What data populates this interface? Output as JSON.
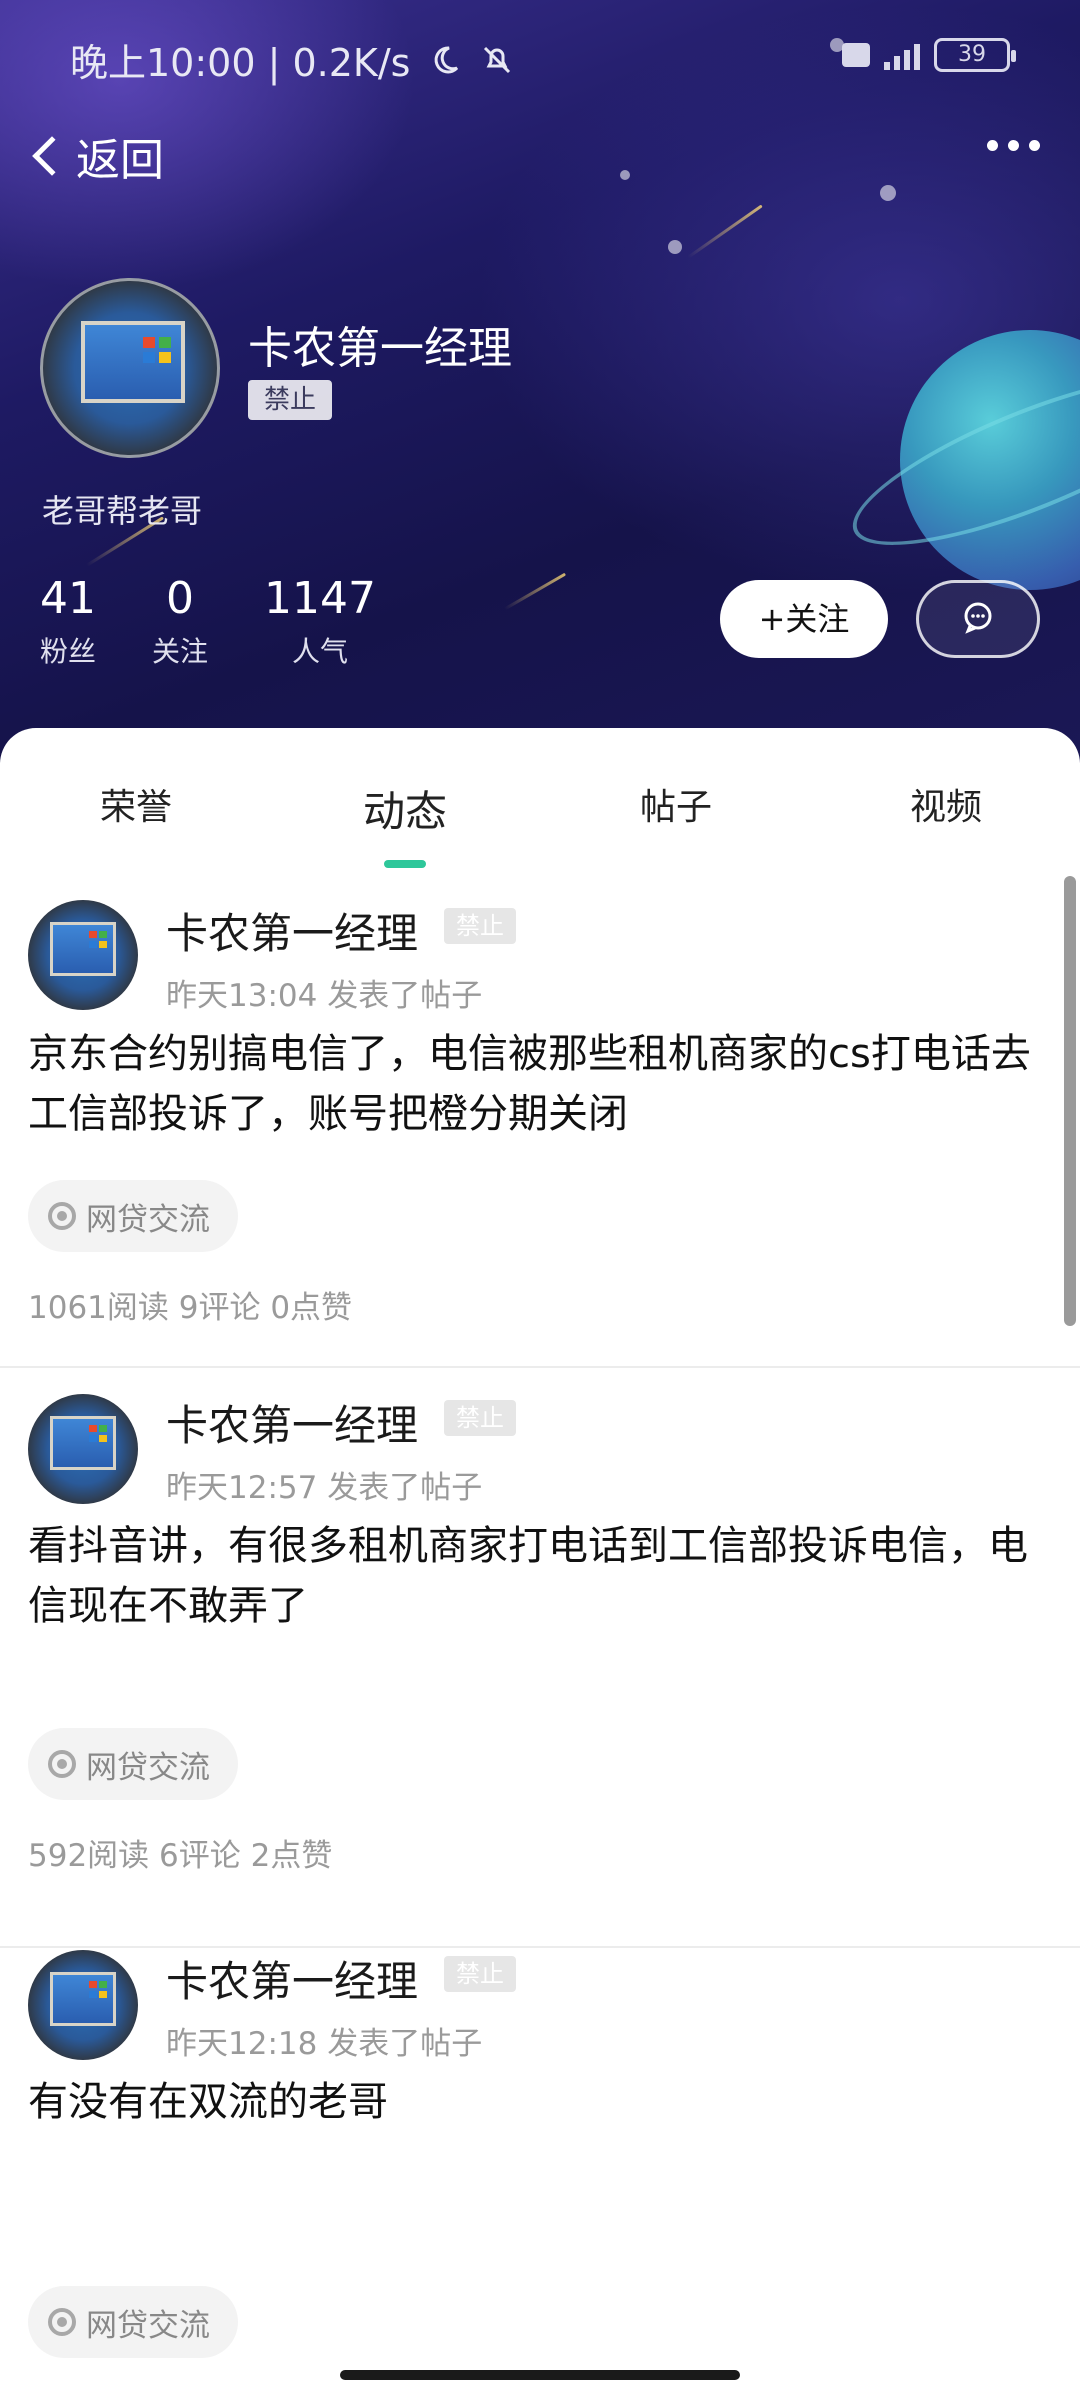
{
  "status_bar": {
    "left_text": "晚上10:00 | 0.2K/s",
    "battery": "39"
  },
  "nav": {
    "back_label": "返回"
  },
  "profile": {
    "name": "卡农第一经理",
    "badge": "禁止",
    "bio": "老哥帮老哥",
    "stats": [
      {
        "value": "41",
        "label": "粉丝"
      },
      {
        "value": "0",
        "label": "关注"
      },
      {
        "value": "1147",
        "label": "人气"
      }
    ],
    "follow_label": "+关注"
  },
  "tabs": [
    {
      "label": "荣誉"
    },
    {
      "label": "动态"
    },
    {
      "label": "帖子"
    },
    {
      "label": "视频"
    }
  ],
  "active_tab": "动态",
  "posts": [
    {
      "name": "卡农第一经理",
      "badge": "禁止",
      "meta": "昨天13:04  发表了帖子",
      "text": "京东合约别搞电信了，电信被那些租机商家的cs打电话去工信部投诉了，账号把橙分期关闭",
      "topic": "网贷交流",
      "stats": "1061阅读  9评论  0点赞"
    },
    {
      "name": "卡农第一经理",
      "badge": "禁止",
      "meta": "昨天12:57  发表了帖子",
      "text": "看抖音讲，有很多租机商家打电话到工信部投诉电信，电信现在不敢弄了",
      "topic": "网贷交流",
      "stats": "592阅读  6评论  2点赞"
    },
    {
      "name": "卡农第一经理",
      "badge": "禁止",
      "meta": "昨天12:18  发表了帖子",
      "text": "有没有在双流的老哥",
      "topic": "网贷交流",
      "stats": ""
    }
  ],
  "colors": {
    "accent": "#2ec79a",
    "header_bg": "#1e1a63",
    "muted_text": "#9a9a9a"
  },
  "icons": {
    "back": "chevron-left-icon",
    "more": "more-dots-icon",
    "message": "chat-bubble-icon",
    "topic": "topic-ring-icon",
    "moon": "moon-icon",
    "mute": "bell-off-icon"
  }
}
